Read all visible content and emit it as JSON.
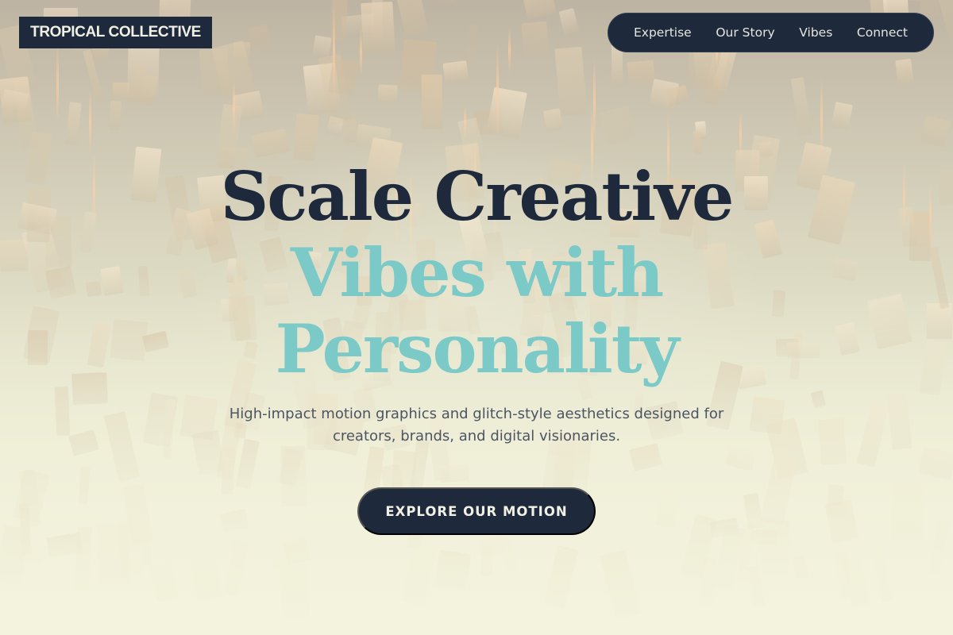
{
  "brand": {
    "name": "TROPICAL COLLECTIVE"
  },
  "nav": {
    "items": [
      {
        "label": "Expertise"
      },
      {
        "label": "Our Story"
      },
      {
        "label": "Vibes"
      },
      {
        "label": "Connect"
      }
    ]
  },
  "hero": {
    "headline_line1": "Scale Creative",
    "headline_line2": "Vibes with",
    "headline_line3": "Personality",
    "subtitle_line1": "High-impact motion graphics and glitch-style aesthetics designed for",
    "subtitle_line2": "creators, brands, and digital visionaries.",
    "cta_label": "EXPLORE OUR MOTION"
  },
  "colors": {
    "navy": "#1e293b",
    "teal": "#7bcac8",
    "cream": "#f4f4de",
    "text_gray": "#4b5563"
  }
}
